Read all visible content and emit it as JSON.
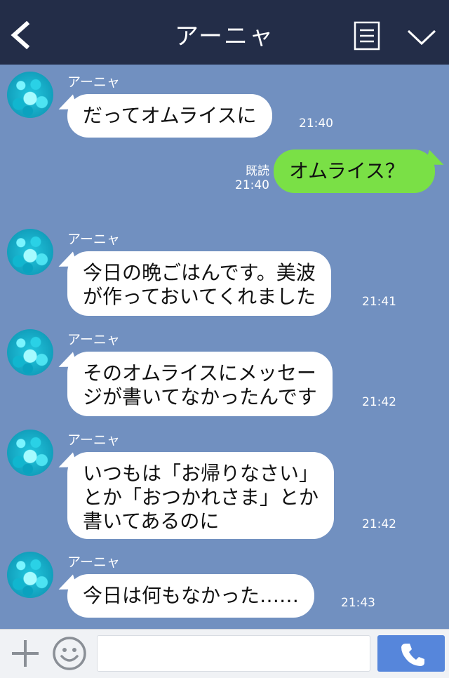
{
  "header": {
    "title": "アーニャ",
    "back_icon": "chevron-left-icon",
    "menu_icon": "menu-list-icon",
    "collapse_icon": "chevron-down-icon"
  },
  "messages": [
    {
      "sender": "アーニャ",
      "text": "だってオムライスに",
      "time": "21:40"
    },
    {
      "text": "オムライス？",
      "read": "既読",
      "time": "21:40"
    },
    {
      "sender": "アーニャ",
      "text": "今日の晩ごはんです。美波\nが作っておいてくれました",
      "time": "21:41"
    },
    {
      "sender": "アーニャ",
      "text": "そのオムライスにメッセー\nジが書いてなかったんです",
      "time": "21:42"
    },
    {
      "sender": "アーニャ",
      "text": "いつもは「お帰りなさい」\nとか「おつかれさま」とか\n書いてあるのに",
      "time": "21:42"
    },
    {
      "sender": "アーニャ",
      "text": "今日は何もなかった……",
      "time": "21:43"
    }
  ],
  "composer": {
    "placeholder": "",
    "plus_icon": "plus-icon",
    "emoji_icon": "emoji-icon",
    "call_icon": "phone-icon"
  },
  "colors": {
    "header_bg": "#232d48",
    "chat_bg": "#7190c0",
    "incoming_bubble": "#ffffff",
    "outgoing_bubble": "#7ae046",
    "call_button": "#5686db"
  }
}
